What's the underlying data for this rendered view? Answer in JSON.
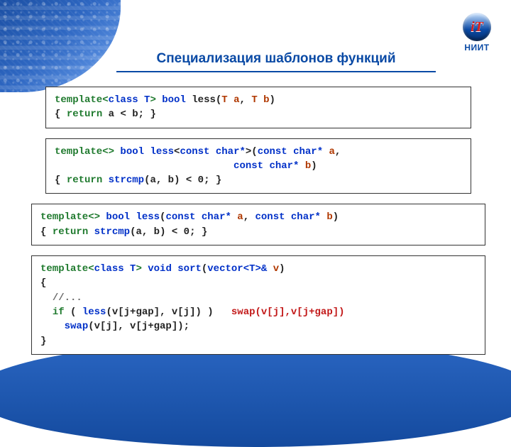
{
  "logo": {
    "monogram": "iT",
    "label": "НИИТ"
  },
  "title": "Специализация шаблонов функций",
  "blocks": {
    "b1": {
      "l1a": "template<",
      "l1b": "class T",
      "l1c": "> ",
      "l1d": "bool",
      "l1e": " less(",
      "l1f": "T a",
      "l1g": ", ",
      "l1h": "T b",
      "l1i": ")",
      "l2a": "{ ",
      "l2b": "return",
      "l2c": " a < b; }"
    },
    "b2": {
      "l1a": "template<> ",
      "l1b": "bool",
      "l1c": " ",
      "l1d": "less",
      "l1e": "<",
      "l1f": "const char*",
      "l1g": ">(",
      "l1h": "const char*",
      "l1i": " ",
      "l1j": "a",
      "l1k": ",",
      "l2pad": "                              ",
      "l2a": "const char*",
      "l2b": " ",
      "l2c": "b",
      "l2d": ")",
      "l3a": "{ ",
      "l3b": "return",
      "l3c": " ",
      "l3d": "strcmp",
      "l3e": "(a, b) < 0; }"
    },
    "b3": {
      "l1a": "template<> ",
      "l1b": "bool",
      "l1c": " ",
      "l1d": "less",
      "l1e": "(",
      "l1f": "const char*",
      "l1g": " ",
      "l1h": "a",
      "l1i": ", ",
      "l1j": "const char*",
      "l1k": " ",
      "l1l": "b",
      "l1m": ")",
      "l2a": "{ ",
      "l2b": "return",
      "l2c": " ",
      "l2d": "strcmp",
      "l2e": "(a, b) < 0; }"
    },
    "b4": {
      "l1a": "template<",
      "l1b": "class T",
      "l1c": "> ",
      "l1d": "void",
      "l1e": " ",
      "l1f": "sort",
      "l1g": "(",
      "l1h": "vector<T>&",
      "l1i": " ",
      "l1j": "v",
      "l1k": ")",
      "l2": "{",
      "l3a": "  ",
      "l3b": "//...",
      "l4a": "  ",
      "l4b": "if",
      "l4c": " ( ",
      "l4d": "less",
      "l4e": "(v[j+gap], v[j]) )   ",
      "l4f": "swap(v[j],v[j+gap])",
      "l5pad": "    ",
      "l5a": "swap",
      "l5b": "(v[j], v[j+gap]);",
      "l6": "}"
    }
  }
}
